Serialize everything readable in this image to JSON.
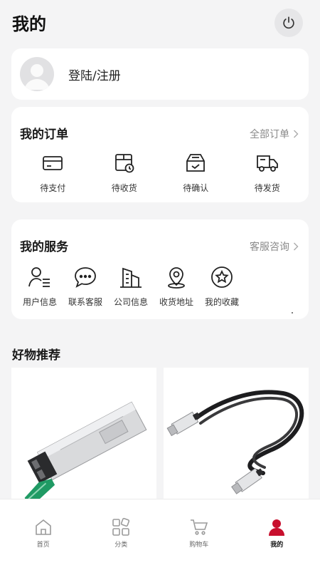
{
  "header": {
    "title": "我的"
  },
  "login": {
    "label": "登陆/注册"
  },
  "orders": {
    "title": "我的订单",
    "all_link": "全部订单",
    "items": [
      {
        "label": "待支付",
        "icon": "card-icon"
      },
      {
        "label": "待收货",
        "icon": "receive-box-icon"
      },
      {
        "label": "待确认",
        "icon": "confirm-box-icon"
      },
      {
        "label": "待发货",
        "icon": "truck-icon"
      }
    ]
  },
  "services": {
    "title": "我的服务",
    "consult_link": "客服咨询",
    "items": [
      {
        "label": "用户信息",
        "icon": "user-list-icon"
      },
      {
        "label": "联系客服",
        "icon": "chat-bubble-icon"
      },
      {
        "label": "公司信息",
        "icon": "building-icon"
      },
      {
        "label": "收货地址",
        "icon": "location-pin-icon"
      },
      {
        "label": "我的收藏",
        "icon": "star-icon"
      }
    ]
  },
  "recommend": {
    "title": "好物推荐"
  },
  "tabbar": {
    "items": [
      {
        "label": "首页",
        "icon": "home-icon"
      },
      {
        "label": "分类",
        "icon": "category-icon"
      },
      {
        "label": "购物车",
        "icon": "cart-icon"
      },
      {
        "label": "我的",
        "icon": "profile-icon",
        "active": true
      }
    ]
  },
  "colors": {
    "accent": "#c8102e",
    "background": "#f4f4f5",
    "muted": "#8a8a8a"
  }
}
